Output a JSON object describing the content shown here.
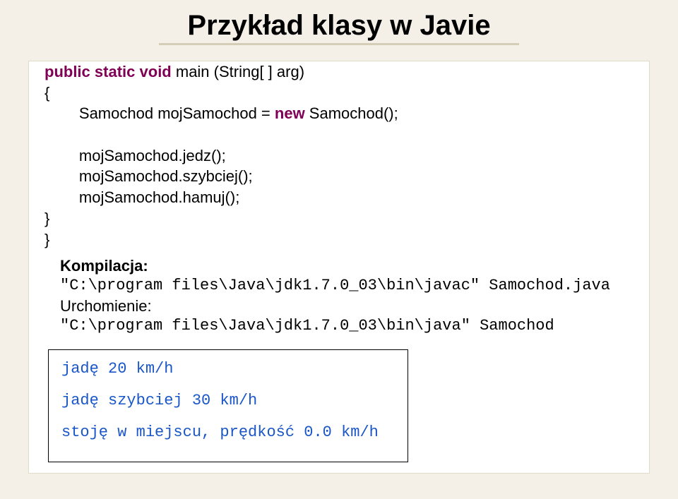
{
  "title": "Przykład klasy w Javie",
  "code": {
    "kw_public": "public",
    "kw_static": "static",
    "kw_void": "void",
    "kw_new": "new",
    "sig_tail": " main (String[ ] arg)",
    "brace_open": "{",
    "brace_close": "}",
    "line_decl_a": "        Samochod mojSamochod = ",
    "line_decl_b": " Samochod();",
    "blank": "",
    "line_jedz": "        mojSamochod.jedz();",
    "line_szybciej": "        mojSamochod.szybciej();",
    "line_hamuj": "        mojSamochod.hamuj();"
  },
  "compile": {
    "label": "Kompilacja:",
    "cmd": "\"C:\\program files\\Java\\jdk1.7.0_03\\bin\\javac\" Samochod.java"
  },
  "run": {
    "label": "Urchomienie:",
    "cmd": "\"C:\\program files\\Java\\jdk1.7.0_03\\bin\\java\" Samochod"
  },
  "output": {
    "l1": "jadę 20 km/h",
    "l2": "jadę szybciej 30 km/h",
    "l3": "stoję w miejscu, prędkość 0.0 km/h"
  }
}
